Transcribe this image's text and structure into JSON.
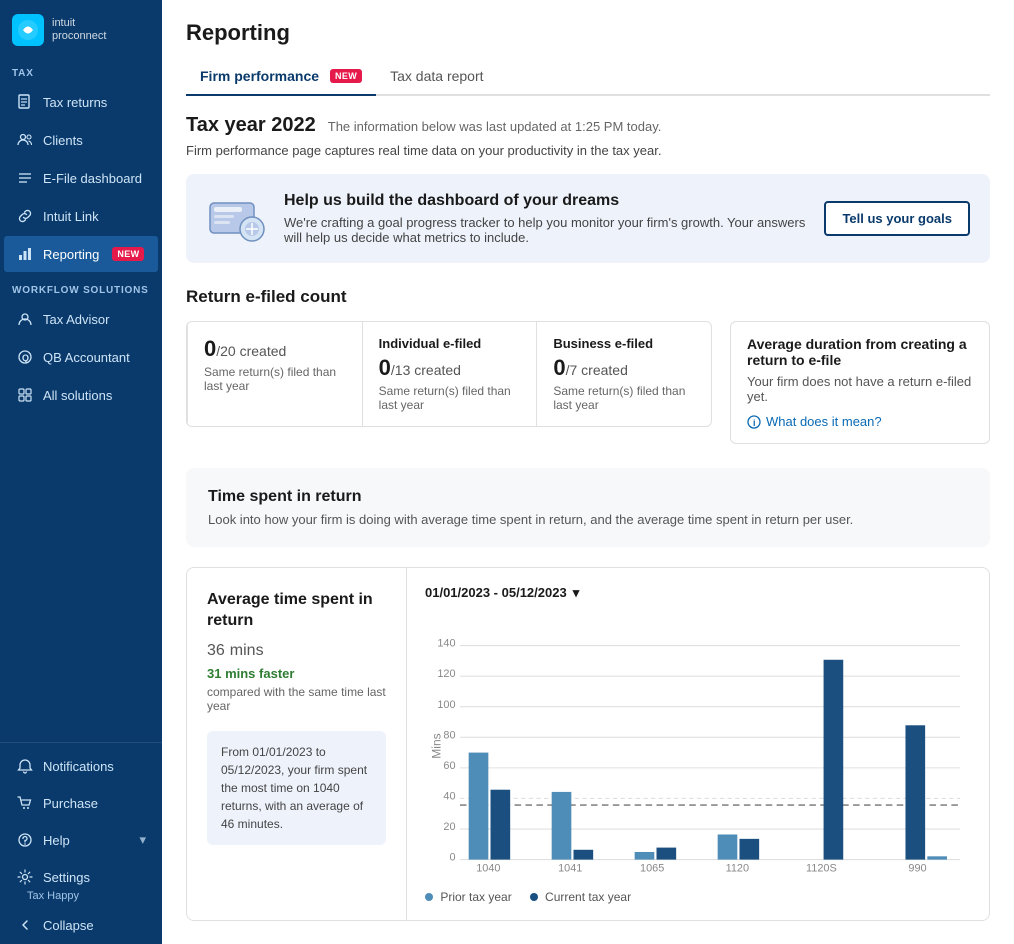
{
  "app": {
    "logo_text": "intuit",
    "logo_sub": "proconnect"
  },
  "sidebar": {
    "tax_label": "TAX",
    "tax_items": [
      {
        "id": "tax-returns",
        "label": "Tax returns",
        "icon": "file-icon"
      },
      {
        "id": "clients",
        "label": "Clients",
        "icon": "people-icon"
      },
      {
        "id": "efile-dashboard",
        "label": "E-File dashboard",
        "icon": "list-icon"
      },
      {
        "id": "intuit-link",
        "label": "Intuit Link",
        "icon": "link-icon"
      },
      {
        "id": "reporting",
        "label": "Reporting",
        "icon": "chart-icon",
        "badge": "NEW"
      }
    ],
    "workflow_label": "WORKFLOW SOLUTIONS",
    "workflow_items": [
      {
        "id": "tax-advisor",
        "label": "Tax Advisor",
        "icon": "advisor-icon"
      },
      {
        "id": "qb-accountant",
        "label": "QB Accountant",
        "icon": "qb-icon"
      },
      {
        "id": "all-solutions",
        "label": "All solutions",
        "icon": "grid-icon"
      }
    ],
    "bottom_items": [
      {
        "id": "notifications",
        "label": "Notifications",
        "icon": "bell-icon"
      },
      {
        "id": "purchase",
        "label": "Purchase",
        "icon": "cart-icon"
      },
      {
        "id": "help",
        "label": "Help",
        "icon": "help-icon",
        "has_chevron": true
      },
      {
        "id": "settings",
        "label": "Settings",
        "icon": "settings-icon",
        "sub": "Tax Happy"
      },
      {
        "id": "collapse",
        "label": "Collapse",
        "icon": "collapse-icon"
      }
    ]
  },
  "page": {
    "title": "Reporting",
    "tabs": [
      {
        "id": "firm-performance",
        "label": "Firm performance",
        "badge": "NEW",
        "active": true
      },
      {
        "id": "tax-data-report",
        "label": "Tax data report",
        "active": false
      }
    ],
    "year_title": "Tax year 2022",
    "year_subtitle": "The information below was last updated at 1:25 PM today.",
    "firm_desc": "Firm performance page captures real time data on your productivity in the tax year.",
    "banner": {
      "title": "Help us build the dashboard of your dreams",
      "desc": "We're crafting a goal progress tracker to help you monitor your firm's growth. Your answers will help us decide what metrics to include.",
      "btn_label": "Tell us your goals"
    },
    "efile": {
      "section_title": "Return e-filed count",
      "cards": [
        {
          "id": "total",
          "label": "",
          "num": "0",
          "of": "/20 created",
          "sub": "Same return(s) filed than last year"
        },
        {
          "id": "individual",
          "label": "Individual e-filed",
          "num": "0",
          "of": "/13 created",
          "sub": "Same return(s) filed than last year"
        },
        {
          "id": "business",
          "label": "Business e-filed",
          "num": "0",
          "of": "/7 created",
          "sub": "Same return(s) filed than last year"
        }
      ],
      "avg_dur": {
        "title": "Average duration from creating a return to e-file",
        "desc": "Your firm does not have a return e-filed yet.",
        "link": "What does it mean?"
      }
    },
    "time_section": {
      "title": "Time spent in return",
      "desc": "Look into how your firm is doing with average time spent in return, and the average time spent in return per user.",
      "avg_card": {
        "label": "Average time spent in return",
        "value": "36",
        "unit": "mins",
        "faster": "31 mins faster",
        "compared": "compared with the same time last year",
        "info": "From 01/01/2023 to 05/12/2023, your firm spent the most time on 1040 returns, with an average of 46 minutes.",
        "date_range": "01/01/2023 - 05/12/2023"
      }
    },
    "chart": {
      "y_label": "Mins",
      "y_max": 140,
      "y_ticks": [
        0,
        20,
        40,
        60,
        80,
        100,
        120,
        140
      ],
      "x_labels": [
        "1040",
        "1041",
        "1065",
        "1120",
        "1120S",
        "990"
      ],
      "prior_bars": [
        70,
        44,
        5,
        16,
        0,
        0
      ],
      "current_bars": [
        46,
        6,
        8,
        13,
        130,
        88
      ],
      "legend": [
        {
          "label": "Prior tax year",
          "color": "#4d8db8"
        },
        {
          "label": "Current tax year",
          "color": "#1a4f80"
        }
      ],
      "avg_line": 36
    }
  }
}
